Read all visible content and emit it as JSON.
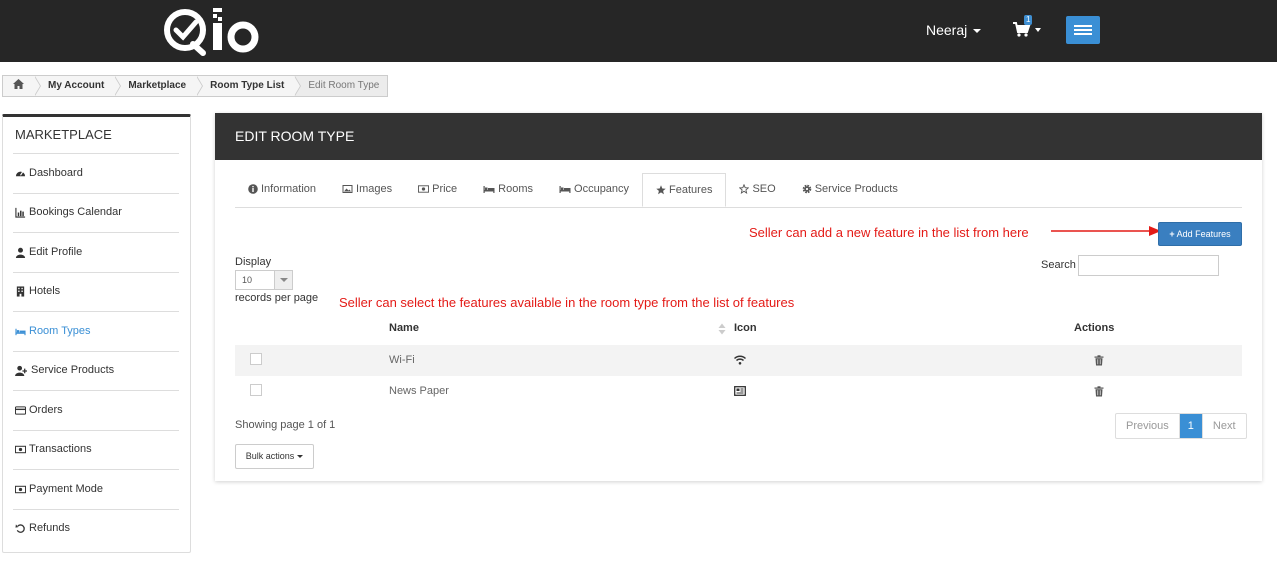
{
  "header": {
    "logo_text": "Qlo",
    "user_name": "Neeraj",
    "cart_count": "1"
  },
  "breadcrumb": {
    "items": [
      "My Account",
      "Marketplace",
      "Room Type List"
    ],
    "current": "Edit Room Type"
  },
  "sidebar": {
    "title": "MARKETPLACE",
    "items": [
      {
        "label": "Dashboard",
        "icon": "dashboard-icon"
      },
      {
        "label": "Bookings Calendar",
        "icon": "bar-chart-icon"
      },
      {
        "label": "Edit Profile",
        "icon": "user-icon"
      },
      {
        "label": "Hotels",
        "icon": "building-icon"
      },
      {
        "label": "Room Types",
        "icon": "bed-icon",
        "active": true
      },
      {
        "label": "Service Products",
        "icon": "user-plus-icon"
      },
      {
        "label": "Orders",
        "icon": "credit-card-icon"
      },
      {
        "label": "Transactions",
        "icon": "money-icon"
      },
      {
        "label": "Payment Mode",
        "icon": "money-icon"
      },
      {
        "label": "Refunds",
        "icon": "undo-icon"
      }
    ]
  },
  "panel": {
    "title": "EDIT ROOM TYPE",
    "tabs": [
      {
        "label": "Information",
        "icon": "info-icon"
      },
      {
        "label": "Images",
        "icon": "image-icon"
      },
      {
        "label": "Price",
        "icon": "money-icon"
      },
      {
        "label": "Rooms",
        "icon": "bed-icon"
      },
      {
        "label": "Occupancy",
        "icon": "bed-icon"
      },
      {
        "label": "Features",
        "icon": "star-icon",
        "active": true
      },
      {
        "label": "SEO",
        "icon": "star-outline-icon"
      },
      {
        "label": "Service Products",
        "icon": "gear-icon"
      }
    ],
    "add_button": "Add Features",
    "annotation_add": "Seller can add a new feature in the list from here",
    "annotation_select": "Seller can select the features available in the room type from the list of features",
    "display_label": "Display",
    "display_value": "10",
    "records_label": "records per page",
    "search_label": "Search",
    "search_value": "",
    "columns": {
      "name": "Name",
      "icon": "Icon",
      "actions": "Actions"
    },
    "rows": [
      {
        "name": "Wi-Fi",
        "icon": "wifi-icon"
      },
      {
        "name": "News Paper",
        "icon": "newspaper-icon"
      }
    ],
    "showing": "Showing page 1 of 1",
    "pagination": {
      "previous": "Previous",
      "page": "1",
      "next": "Next"
    },
    "bulk_actions": "Bulk actions"
  },
  "colors": {
    "topbar": "#262626",
    "accent": "#3a8fd5",
    "annotation": "#e41b17"
  }
}
